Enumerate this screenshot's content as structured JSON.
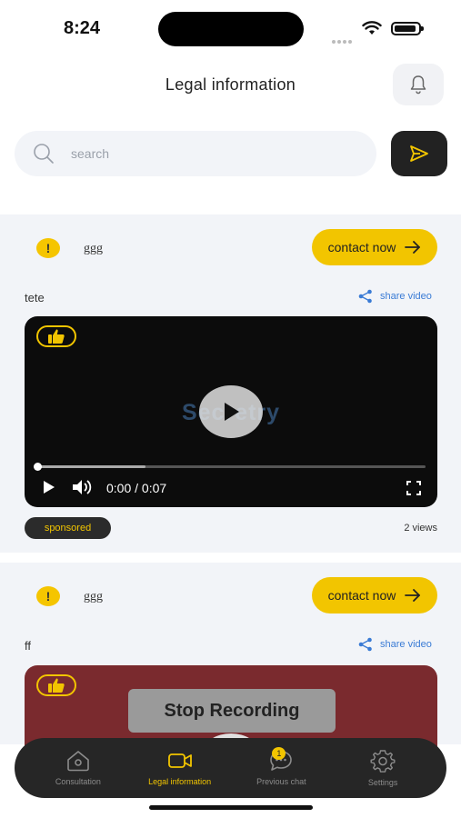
{
  "status_bar": {
    "time": "8:24"
  },
  "header": {
    "title": "Legal information",
    "bell_icon": "bell-icon"
  },
  "search": {
    "placeholder": "search",
    "value": "",
    "send_icon": "send-icon"
  },
  "posts": [
    {
      "author": "ggg",
      "contact_label": "contact now",
      "title": "tete",
      "share_label": "share video",
      "video": {
        "watermark": "Secretry",
        "time": "0:00 / 0:07",
        "progress": 0.0
      },
      "sponsored_label": "sponsored",
      "views": "2 views"
    },
    {
      "author": "ggg",
      "contact_label": "contact now",
      "title": "ff",
      "share_label": "share video",
      "video": {
        "overlay_text": "Stop Recording"
      }
    }
  ],
  "nav": {
    "items": [
      {
        "label": "Consultation",
        "icon": "home-icon"
      },
      {
        "label": "Legal information",
        "icon": "video-icon"
      },
      {
        "label": "Previous chat",
        "icon": "chat-icon",
        "badge": "1"
      },
      {
        "label": "Settings",
        "icon": "gear-icon"
      }
    ],
    "active_index": 1
  },
  "colors": {
    "accent": "#f2c500",
    "link": "#3a7bd5",
    "dark": "#262626",
    "card_bg": "#f2f4f8"
  }
}
